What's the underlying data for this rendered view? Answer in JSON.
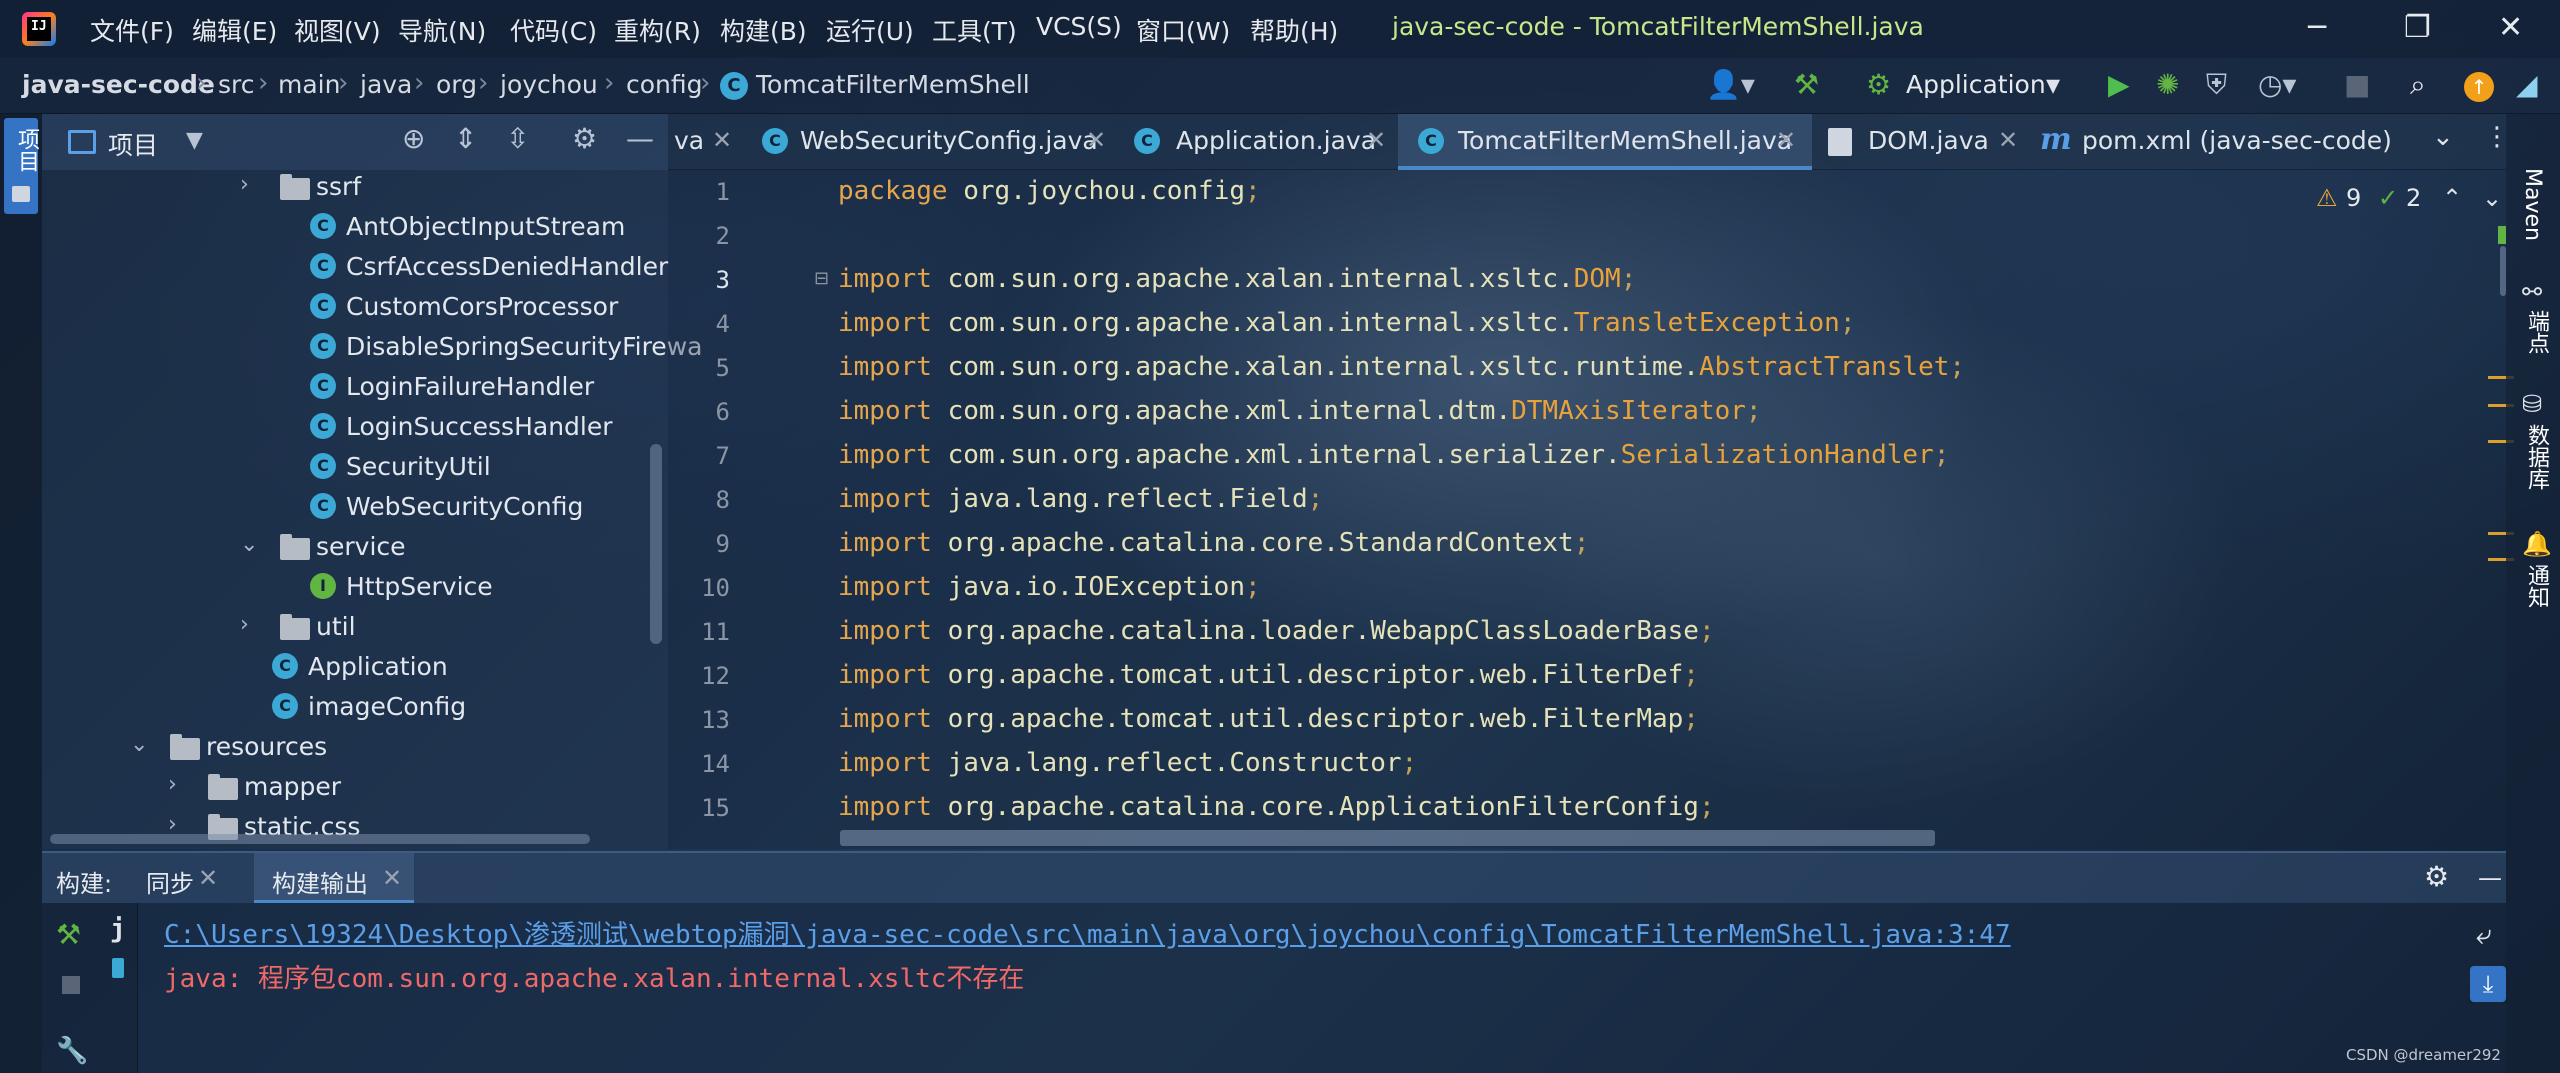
{
  "app": {
    "window_title": "java-sec-code - TomcatFilterMemShell.java",
    "menu": [
      "文件(F)",
      "编辑(E)",
      "视图(V)",
      "导航(N)",
      "代码(C)",
      "重构(R)",
      "构建(B)",
      "运行(U)",
      "工具(T)",
      "VCS(S)",
      "窗口(W)",
      "帮助(H)"
    ]
  },
  "breadcrumb": [
    "java-sec-code",
    "src",
    "main",
    "java",
    "org",
    "joychou",
    "config",
    "TomcatFilterMemShell"
  ],
  "toolbar": {
    "run_config": "Application"
  },
  "left_stripe": {
    "project_label": "项目"
  },
  "project_panel": {
    "title": "项目",
    "tree": [
      {
        "label": "ssrf",
        "kind": "folder",
        "expanded": false
      },
      {
        "label": "AntObjectInputStream",
        "kind": "class"
      },
      {
        "label": "CsrfAccessDeniedHandler",
        "kind": "class"
      },
      {
        "label": "CustomCorsProcessor",
        "kind": "class"
      },
      {
        "label": "DisableSpringSecurityFirewa",
        "kind": "class"
      },
      {
        "label": "LoginFailureHandler",
        "kind": "class"
      },
      {
        "label": "LoginSuccessHandler",
        "kind": "class"
      },
      {
        "label": "SecurityUtil",
        "kind": "class"
      },
      {
        "label": "WebSecurityConfig",
        "kind": "class"
      },
      {
        "label": "service",
        "kind": "folder",
        "expanded": true
      },
      {
        "label": "HttpService",
        "kind": "interface"
      },
      {
        "label": "util",
        "kind": "folder",
        "expanded": false
      },
      {
        "label": "Application",
        "kind": "class"
      },
      {
        "label": "imageConfig",
        "kind": "class"
      },
      {
        "label": "resources",
        "kind": "folder",
        "expanded": true
      },
      {
        "label": "mapper",
        "kind": "folder",
        "expanded": false
      },
      {
        "label": "static.css",
        "kind": "folder",
        "expanded": false
      }
    ]
  },
  "tabs": [
    {
      "label": "va",
      "active": false
    },
    {
      "label": "WebSecurityConfig.java",
      "active": false
    },
    {
      "label": "Application.java",
      "active": false
    },
    {
      "label": "TomcatFilterMemShell.java",
      "active": true
    },
    {
      "label": "DOM.java",
      "active": false
    },
    {
      "label": "pom.xml (java-sec-code)",
      "active": false
    }
  ],
  "editor": {
    "warnings_count": "9",
    "weak_warnings_count": "2",
    "lines": [
      {
        "n": "1",
        "kw": "package",
        "pkg": "org.joychou.config",
        "cls": "",
        "semi": ";"
      },
      {
        "n": "2",
        "kw": "",
        "pkg": "",
        "cls": "",
        "semi": ""
      },
      {
        "n": "3",
        "kw": "import",
        "pkg": "com.sun.org.apache.xalan.internal.xsltc.",
        "cls": "DOM",
        "semi": ";"
      },
      {
        "n": "4",
        "kw": "import",
        "pkg": "com.sun.org.apache.xalan.internal.xsltc.",
        "cls": "TransletException",
        "semi": ";"
      },
      {
        "n": "5",
        "kw": "import",
        "pkg": "com.sun.org.apache.xalan.internal.xsltc.runtime.",
        "cls": "AbstractTranslet",
        "semi": ";"
      },
      {
        "n": "6",
        "kw": "import",
        "pkg": "com.sun.org.apache.xml.internal.dtm.",
        "cls": "DTMAxisIterator",
        "semi": ";"
      },
      {
        "n": "7",
        "kw": "import",
        "pkg": "com.sun.org.apache.xml.internal.serializer.",
        "cls": "SerializationHandler",
        "semi": ";"
      },
      {
        "n": "8",
        "kw": "import",
        "pkg": "java.lang.reflect.Field",
        "cls": "",
        "semi": ";"
      },
      {
        "n": "9",
        "kw": "import",
        "pkg": "org.apache.catalina.core.StandardContext",
        "cls": "",
        "semi": ";"
      },
      {
        "n": "10",
        "kw": "import",
        "pkg": "java.io.IOException",
        "cls": "",
        "semi": ";"
      },
      {
        "n": "11",
        "kw": "import",
        "pkg": "org.apache.catalina.loader.WebappClassLoaderBase",
        "cls": "",
        "semi": ";"
      },
      {
        "n": "12",
        "kw": "import",
        "pkg": "org.apache.tomcat.util.descriptor.web.FilterDef",
        "cls": "",
        "semi": ";"
      },
      {
        "n": "13",
        "kw": "import",
        "pkg": "org.apache.tomcat.util.descriptor.web.FilterMap",
        "cls": "",
        "semi": ";"
      },
      {
        "n": "14",
        "kw": "import",
        "pkg": "java.lang.reflect.Constructor",
        "cls": "",
        "semi": ";"
      },
      {
        "n": "15",
        "kw": "import",
        "pkg": "org.apache.catalina.core.ApplicationFilterConfig",
        "cls": "",
        "semi": ";"
      }
    ]
  },
  "right_stripe": [
    "Maven",
    "端点",
    "数据库",
    "通知"
  ],
  "build_panel": {
    "label": "构建:",
    "tabs": [
      "同步",
      "构建输出"
    ],
    "output_path": "C:\\Users\\19324\\Desktop\\渗透测试\\webtop漏洞\\java-sec-code\\src\\main\\java\\org\\joychou\\config\\TomcatFilterMemShell.java:3:47",
    "error_prefix": "java: ",
    "error_message": "程序包com.sun.org.apache.xalan.internal.xsltc不存在",
    "tree_marker": "j"
  },
  "watermark": "CSDN @dreamer292"
}
